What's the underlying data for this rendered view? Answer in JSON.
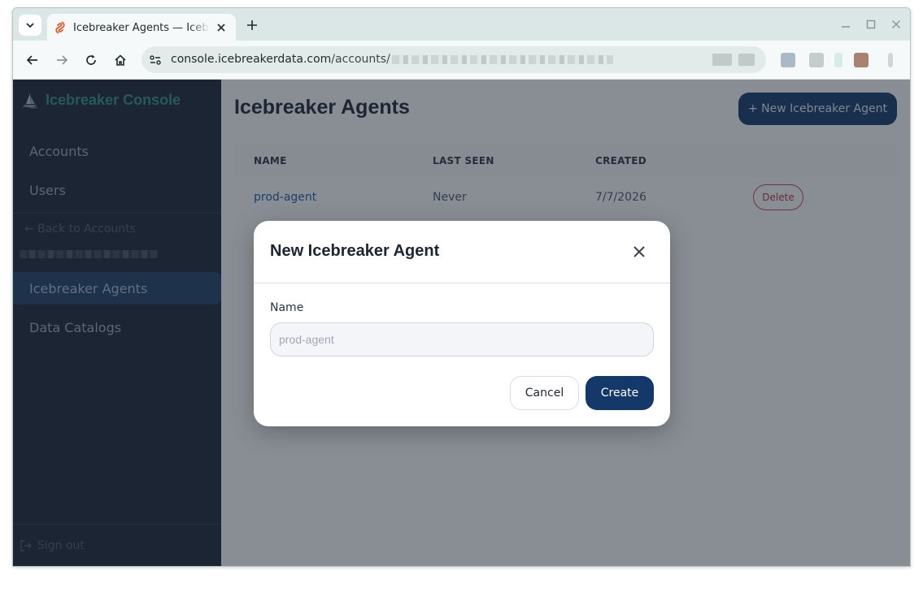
{
  "browser": {
    "tab_title": "Icebreaker Agents — Icebreaker Console",
    "url_host": "console.icebreakerdata.com",
    "url_path": "/accounts/"
  },
  "sidebar": {
    "brand": "Icebreaker Console",
    "items": [
      {
        "label": "Accounts"
      },
      {
        "label": "Users"
      },
      {
        "label": "Icebreaker Agents",
        "active": true
      },
      {
        "label": "Data Catalogs"
      }
    ],
    "back_link": "← Back to Accounts",
    "sign_out": "Sign out"
  },
  "main": {
    "title": "Icebreaker Agents",
    "new_button": "+ New Icebreaker Agent",
    "table": {
      "columns": [
        "NAME",
        "LAST SEEN",
        "CREATED"
      ],
      "rows": [
        {
          "name": "prod-agent",
          "last_seen": "Never",
          "created": "7/7/2026",
          "action": "Delete"
        }
      ]
    }
  },
  "modal": {
    "title": "New Icebreaker Agent",
    "field_label": "Name",
    "placeholder": "prod-agent",
    "value": "",
    "cancel": "Cancel",
    "create": "Create"
  },
  "colors": {
    "accent": "#14386a",
    "brand": "#2d8c86",
    "sidebar_bg": "#1a2436",
    "danger": "#b9323c"
  }
}
